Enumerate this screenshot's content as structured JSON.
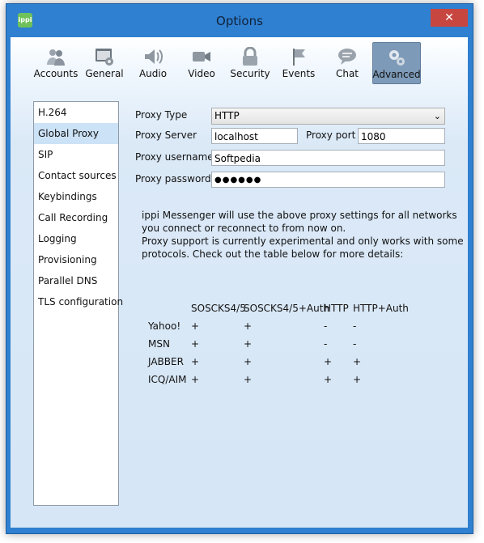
{
  "window": {
    "title": "Options",
    "app_icon": "ippi",
    "close_glyph": "✕"
  },
  "toolbar": [
    {
      "label": "Accounts",
      "icon": "accounts-icon"
    },
    {
      "label": "General",
      "icon": "general-icon"
    },
    {
      "label": "Audio",
      "icon": "audio-icon"
    },
    {
      "label": "Video",
      "icon": "video-icon"
    },
    {
      "label": "Security",
      "icon": "security-icon"
    },
    {
      "label": "Events",
      "icon": "events-icon"
    },
    {
      "label": "Chat",
      "icon": "chat-icon"
    },
    {
      "label": "Advanced",
      "icon": "advanced-icon",
      "active": true
    }
  ],
  "sidebar": {
    "items": [
      "H.264",
      "Global Proxy",
      "SIP",
      "Contact sources",
      "Keybindings",
      "Call Recording",
      "Logging",
      "Provisioning",
      "Parallel DNS",
      "TLS configuration"
    ],
    "selected": "Global Proxy"
  },
  "form": {
    "proxy_type_label": "Proxy Type",
    "proxy_type_value": "HTTP",
    "proxy_server_label": "Proxy Server",
    "proxy_server_value": "localhost",
    "proxy_port_label": "Proxy port",
    "proxy_port_value": "1080",
    "username_label": "Proxy username",
    "username_value": "Softpedia",
    "password_label": "Proxy password",
    "password_value": "●●●●●●"
  },
  "info": {
    "line1": "ippi Messenger will use the above proxy settings for all networks",
    "line2": "you connect or reconnect to from now on.",
    "line3": "Proxy support is currently experimental and only works with some",
    "line4": "protocols. Check out the table below for more details:"
  },
  "table": {
    "headers": [
      "SOSCKS4/5",
      "SOSCKS4/5+Auth",
      "HTTP",
      "HTTP+Auth"
    ],
    "rows": [
      {
        "name": "Yahoo!",
        "values": [
          "+",
          "+",
          "-",
          "-"
        ]
      },
      {
        "name": "MSN",
        "values": [
          "+",
          "+",
          "-",
          "-"
        ]
      },
      {
        "name": "JABBER",
        "values": [
          "+",
          "+",
          "+",
          "+"
        ]
      },
      {
        "name": "ICQ/AIM",
        "values": [
          "+",
          "+",
          "+",
          "+"
        ]
      }
    ]
  },
  "colors": {
    "frame": "#2f80d1",
    "close": "#c7463f",
    "selection": "#cce2f6"
  }
}
